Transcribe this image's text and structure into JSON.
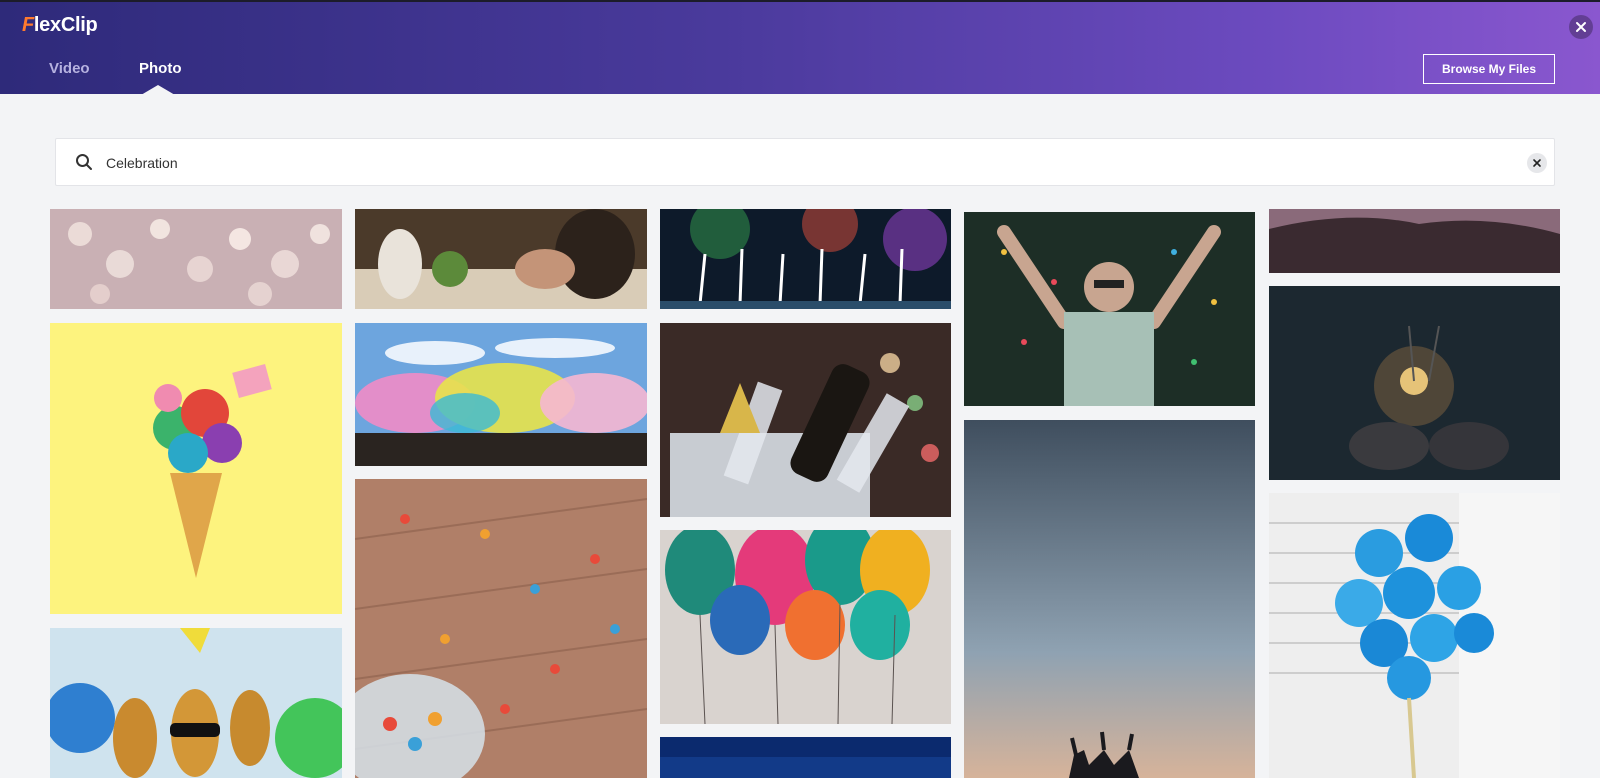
{
  "app": {
    "logo_first": "F",
    "logo_rest": "lexClip"
  },
  "tabs": [
    {
      "label": "Video",
      "active": false
    },
    {
      "label": "Photo",
      "active": true
    }
  ],
  "header": {
    "browse_label": "Browse My Files"
  },
  "search": {
    "value": "Celebration"
  },
  "colors": {
    "accent_orange": "#ff7a2e",
    "header_start": "#2e2a7a",
    "header_end": "#8a57cf"
  },
  "photos": [
    {
      "name": "photo-bokeh-lights"
    },
    {
      "name": "photo-ice-cream-cone-confetti"
    },
    {
      "name": "photo-pineapples-party-hats"
    },
    {
      "name": "photo-people-toasting"
    },
    {
      "name": "photo-holi-color-festival"
    },
    {
      "name": "photo-confetti-wooden-floor"
    },
    {
      "name": "photo-fireworks"
    },
    {
      "name": "photo-champagne-ice-bucket"
    },
    {
      "name": "photo-balloons"
    },
    {
      "name": "photo-night-sky"
    },
    {
      "name": "photo-man-confetti"
    },
    {
      "name": "photo-silhouettes-sunset"
    },
    {
      "name": "photo-rocky-dusk"
    },
    {
      "name": "photo-sparklers"
    },
    {
      "name": "photo-blue-balloons"
    }
  ]
}
